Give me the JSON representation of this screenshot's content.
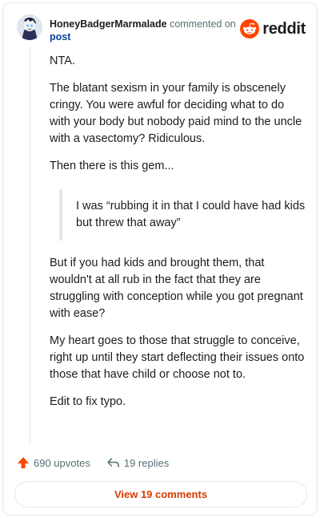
{
  "header": {
    "author": "HoneyBadgerMarmalade",
    "action": "commented on",
    "post_link": "post",
    "brand": "reddit"
  },
  "comment": {
    "paragraphs": [
      "NTA.",
      "The blatant sexism in your family is obscenely cringy. You were awful for deciding what to do with your body but nobody paid mind to the uncle with a vasectomy? Ridiculous.",
      "Then there is this gem..."
    ],
    "quote": "I was “rubbing it in that I could have had kids but threw that away”",
    "paragraphs_after": [
      "But if you had kids and brought them, that wouldn't at all rub in the fact that they are struggling with conception while you got pregnant with ease?",
      "My heart goes to those that struggle to conceive, right up until they start deflecting their issues onto those that have child or choose not to.",
      "Edit to fix typo."
    ]
  },
  "footer": {
    "upvotes": "690 upvotes",
    "replies": "19 replies",
    "view_comments": "View 19 comments"
  },
  "colors": {
    "brand_orange": "#ff4500",
    "link_blue": "#0a449b",
    "button_text": "#d93a00"
  },
  "icons": {
    "upvote": "upvote-arrow-icon",
    "reply": "reply-arrow-icon",
    "brand": "reddit-snoo-icon"
  }
}
